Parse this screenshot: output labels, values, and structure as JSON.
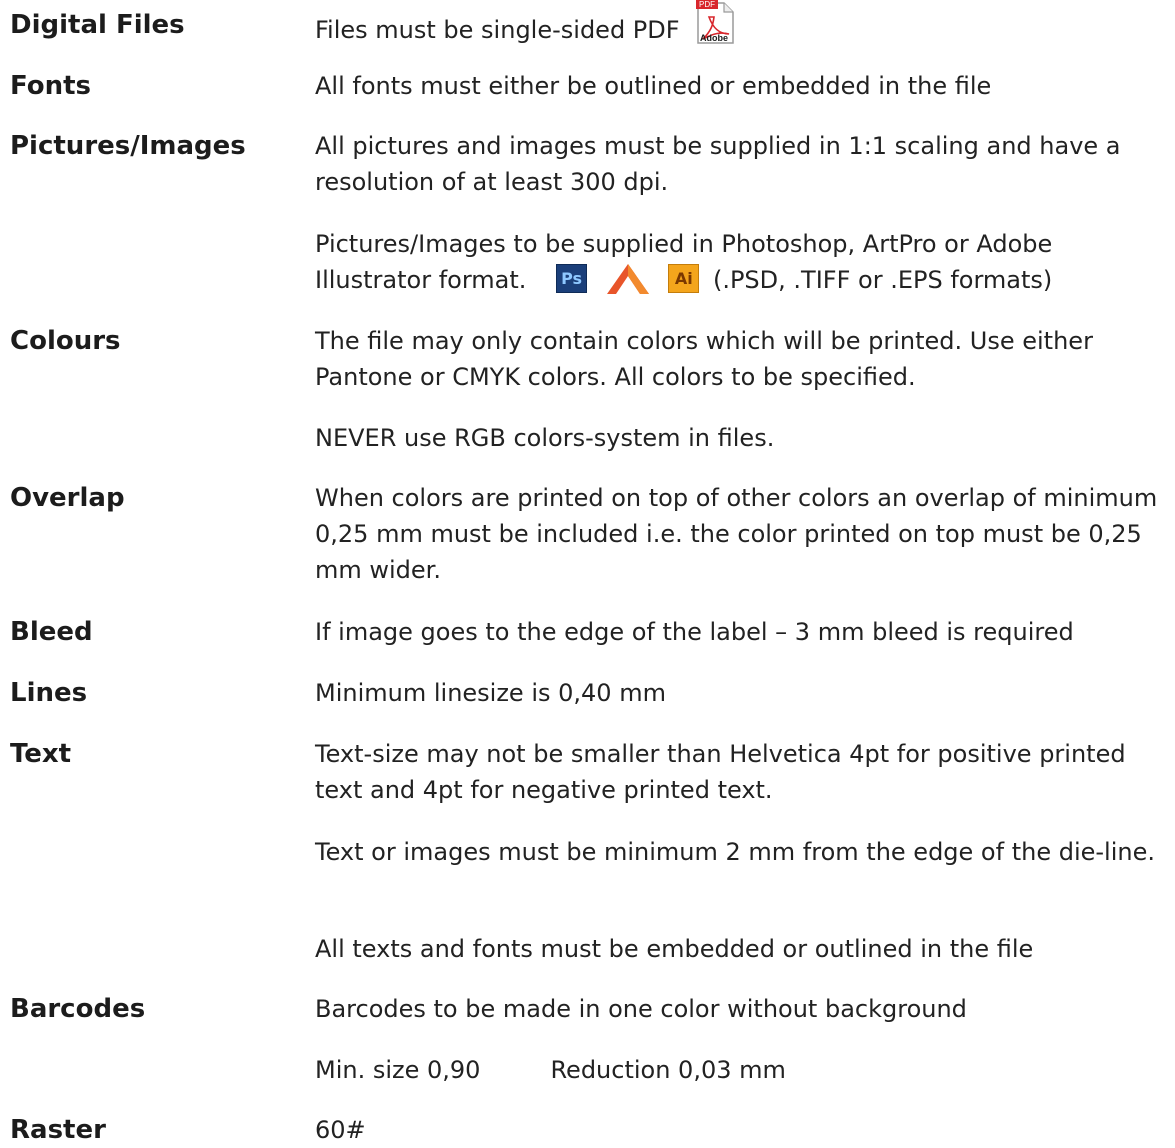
{
  "rows": [
    {
      "term": "Digital Files",
      "text": "Files must be single-sided PDF"
    },
    {
      "term": "Fonts",
      "text": "All fonts must either be outlined or embedded in the file"
    },
    {
      "term": "Pictures/Images",
      "text": "All pictures and images must be supplied in 1:1 scaling and have a resolution of at least 300 dpi."
    },
    {
      "term": "Colours",
      "text": "The file may only contain colors which will be printed. Use either Pantone or CMYK colors. All colors to be specified."
    },
    {
      "term": "Overlap",
      "text": "When colors are printed on top of other colors an overlap of minimum 0,25 mm must be included i.e. the color printed on top must be 0,25 mm wider."
    },
    {
      "term": "Bleed",
      "text": "If image goes to the edge of the label – 3 mm bleed is required"
    },
    {
      "term": "Lines",
      "text": "Minimum linesize is 0,40 mm"
    },
    {
      "term": "Text",
      "text": "Text-size may not be smaller than Helvetica 4pt for positive printed text and 4pt for negative printed text."
    },
    {
      "term": "Barcodes",
      "text": "Barcodes to be made in one color without background"
    },
    {
      "term": "Raster",
      "text": "60#"
    }
  ],
  "images_formats": {
    "text_before": "Pictures/Images to be supplied in Photoshop, ArtPro or Adobe Illustrator format.",
    "text_after": "(.PSD, .TIFF or .EPS formats)",
    "ps_icon_label": "Ps",
    "ai_icon_label": "Ai"
  },
  "pdf_icon": {
    "tag": "PDF",
    "label": "Adobe"
  },
  "colours_note": "NEVER use RGB colors-system in files.",
  "text_note_1": "Text or images must be minimum 2 mm from the edge of the die-line.",
  "text_note_2": "All texts and fonts must be embedded or outlined in the file",
  "barcodes_min_size": "Min. size 0,90",
  "barcodes_reduction": "Reduction 0,03 mm",
  "colors": {
    "text": "#222222",
    "ps_badge": "#1b3f7a",
    "ai_badge": "#f4a51c",
    "pdf_red": "#d8262c",
    "artpro": "#e8552a"
  }
}
